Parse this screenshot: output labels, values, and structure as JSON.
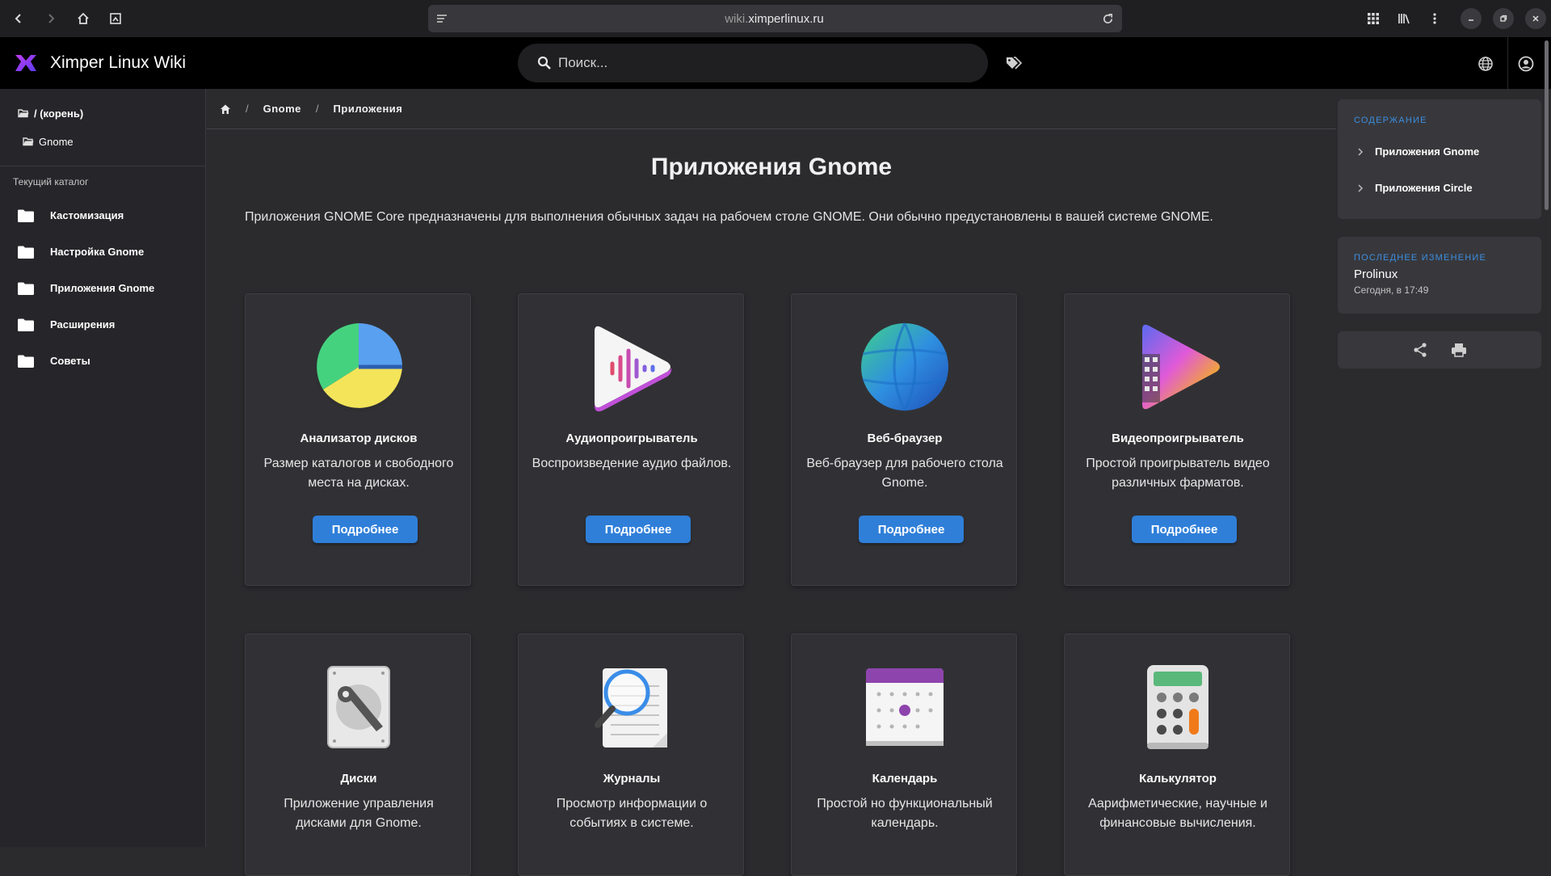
{
  "browser": {
    "url_prefix": "wiki.",
    "url_domain": "ximperlinux.ru"
  },
  "header": {
    "title": "Ximper Linux Wiki",
    "search_placeholder": "Поиск..."
  },
  "sidebar": {
    "tree_root": "/ (корень)",
    "tree_child": "Gnome",
    "caption": "Текущий каталог",
    "items": [
      {
        "label": "Кастомизация"
      },
      {
        "label": "Настройка Gnome"
      },
      {
        "label": "Приложения Gnome"
      },
      {
        "label": "Расширения"
      },
      {
        "label": "Советы"
      }
    ]
  },
  "breadcrumb": {
    "items": [
      "Gnome",
      "Приложения"
    ]
  },
  "main": {
    "title": "Приложения Gnome",
    "intro": "Приложения GNOME Core предназначены для выполнения обычных задач на рабочем столе GNOME. Они обычно предустановлены в вашей системе GNOME.",
    "more_label": "Подробнее",
    "cards": [
      {
        "title": "Анализатор дисков",
        "desc": "Размер каталогов и свободного места на дисках.",
        "icon": "disk-usage-analyzer-icon"
      },
      {
        "title": "Аудиопроигрыватель",
        "desc": "Воспроизведение аудио файлов.",
        "icon": "audio-player-icon"
      },
      {
        "title": "Веб-браузер",
        "desc": "Веб-браузер для рабочего стола Gnome.",
        "icon": "web-browser-icon"
      },
      {
        "title": "Видеопроигрыватель",
        "desc": "Простой проигрыватель видео различных фарматов.",
        "icon": "video-player-icon"
      },
      {
        "title": "Диски",
        "desc": "Приложение управления дисками для Gnome.",
        "icon": "disks-icon"
      },
      {
        "title": "Журналы",
        "desc": "Просмотр информации о событиях в системе.",
        "icon": "logs-icon"
      },
      {
        "title": "Календарь",
        "desc": "Простой но функциональный календарь.",
        "icon": "calendar-icon"
      },
      {
        "title": "Калькулятор",
        "desc": "Аарифметические, научные и финансовые вычисления.",
        "icon": "calculator-icon"
      }
    ]
  },
  "toc": {
    "label": "СОДЕРЖАНИЕ",
    "items": [
      {
        "label": "Приложения Gnome"
      },
      {
        "label": "Приложения Circle"
      }
    ]
  },
  "last_change": {
    "label": "ПОСЛЕДНЕЕ ИЗМЕНЕНИЕ",
    "author": "Prolinux",
    "date": "Сегодня, в 17:49"
  },
  "colors": {
    "accent": "#2f7fd9",
    "label_blue": "#3c8ee0",
    "background": "#2b2b2e"
  }
}
